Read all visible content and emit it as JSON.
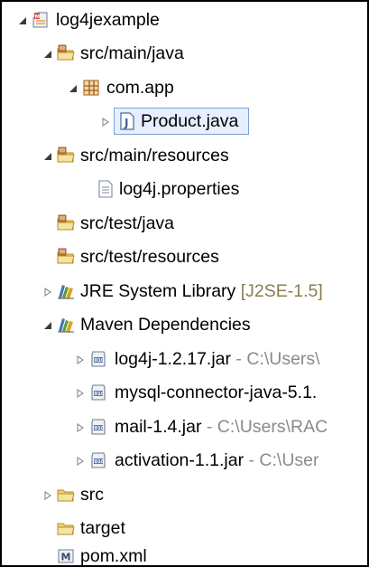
{
  "tree": {
    "project": {
      "label": "log4jexample",
      "icon": "maven-project-icon"
    },
    "src_main_java": {
      "label": "src/main/java",
      "icon": "source-folder-icon"
    },
    "package_app": {
      "label": "com.app",
      "icon": "package-icon"
    },
    "product_java": {
      "label": "Product.java",
      "icon": "java-file-icon"
    },
    "src_main_resources": {
      "label": "src/main/resources",
      "icon": "source-folder-icon"
    },
    "log4j_properties": {
      "label": "log4j.properties",
      "icon": "properties-file-icon"
    },
    "src_test_java": {
      "label": "src/test/java",
      "icon": "source-folder-icon"
    },
    "src_test_resources": {
      "label": "src/test/resources",
      "icon": "source-folder-icon"
    },
    "jre_library": {
      "label": "JRE System Library",
      "decoration": "[J2SE-1.5]",
      "icon": "library-icon"
    },
    "maven_dependencies": {
      "label": "Maven Dependencies",
      "icon": "library-icon"
    },
    "jar_log4j": {
      "label": "log4j-1.2.17.jar",
      "decoration": "- C:\\Users\\",
      "icon": "jar-icon"
    },
    "jar_mysql": {
      "label": "mysql-connector-java-5.1.",
      "icon": "jar-icon"
    },
    "jar_mail": {
      "label": "mail-1.4.jar",
      "decoration": "- C:\\Users\\RAC",
      "icon": "jar-icon"
    },
    "jar_activation": {
      "label": "activation-1.1.jar",
      "decoration": "- C:\\User",
      "icon": "jar-icon"
    },
    "src": {
      "label": "src",
      "icon": "folder-icon"
    },
    "target": {
      "label": "target",
      "icon": "folder-icon"
    },
    "pom": {
      "label": "pom.xml",
      "icon": "maven-pom-icon"
    }
  },
  "colors": {
    "selection_border": "#7da2ce",
    "selection_fill": "#e6efff",
    "decoration_gray": "#8a8a8a",
    "decoration_lib": "#8a7d4e"
  }
}
